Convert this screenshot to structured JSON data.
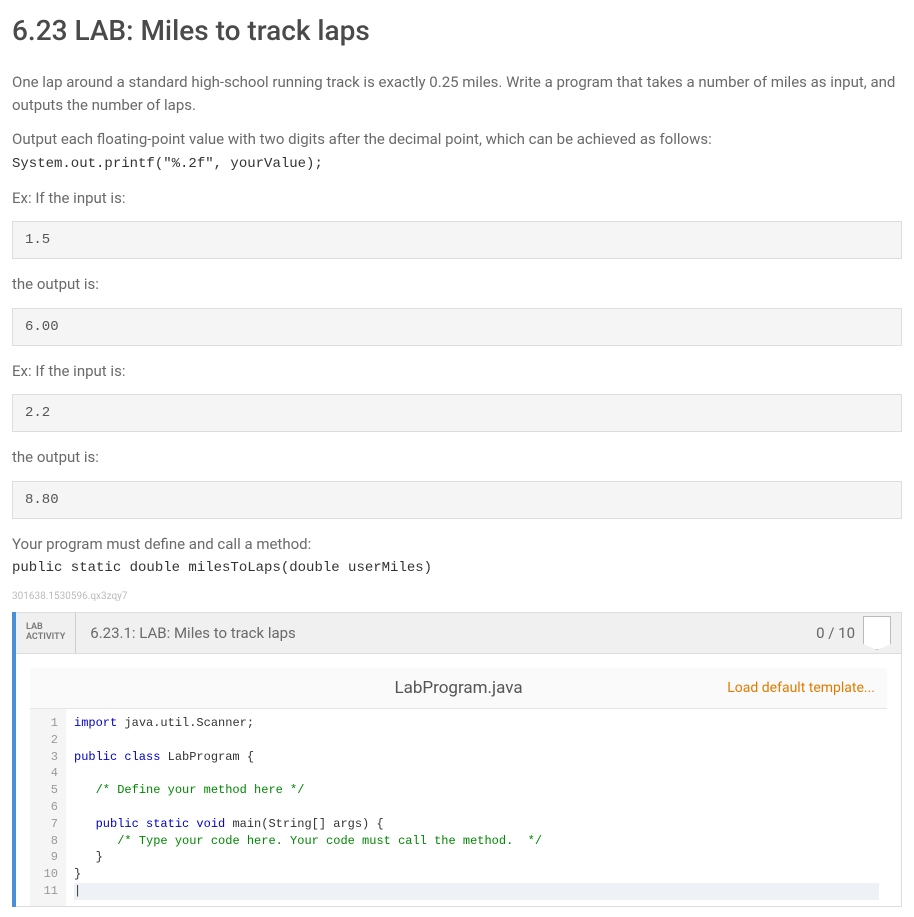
{
  "title": "6.23 LAB: Miles to track laps",
  "intro": "One lap around a standard high-school running track is exactly 0.25 miles. Write a program that takes a number of miles as input, and outputs the number of laps.",
  "output_instr": "Output each floating-point value with two digits after the decimal point, which can be achieved as follows:",
  "output_code": "System.out.printf(\"%.2f\", yourValue);",
  "ex_label_input": "Ex: If the input is:",
  "ex_label_output": "the output is:",
  "examples": [
    {
      "input": "1.5",
      "output": "6.00"
    },
    {
      "input": "2.2",
      "output": "8.80"
    }
  ],
  "method_instr": "Your program must define and call a method:",
  "method_signature": "public static double milesToLaps(double userMiles)",
  "watermark": "301638.1530596.qx3zqy7",
  "lab": {
    "label_top": "LAB",
    "label_bottom": "ACTIVITY",
    "title": "6.23.1: LAB: Miles to track laps",
    "score": "0 / 10",
    "filename": "LabProgram.java",
    "load_template": "Load default template...",
    "code_lines": [
      {
        "n": 1,
        "tokens": [
          {
            "t": "import ",
            "c": "kw"
          },
          {
            "t": "java.util.Scanner;",
            "c": ""
          }
        ]
      },
      {
        "n": 2,
        "tokens": []
      },
      {
        "n": 3,
        "tokens": [
          {
            "t": "public class ",
            "c": "kw"
          },
          {
            "t": "LabProgram {",
            "c": ""
          }
        ]
      },
      {
        "n": 4,
        "tokens": []
      },
      {
        "n": 5,
        "tokens": [
          {
            "t": "   ",
            "c": ""
          },
          {
            "t": "/* Define your method here */",
            "c": "com"
          }
        ]
      },
      {
        "n": 6,
        "tokens": []
      },
      {
        "n": 7,
        "tokens": [
          {
            "t": "   ",
            "c": ""
          },
          {
            "t": "public static void ",
            "c": "kw"
          },
          {
            "t": "main(String[] args) {",
            "c": ""
          }
        ]
      },
      {
        "n": 8,
        "tokens": [
          {
            "t": "      ",
            "c": ""
          },
          {
            "t": "/* Type your code here. Your code must call the method.  */",
            "c": "com"
          }
        ]
      },
      {
        "n": 9,
        "tokens": [
          {
            "t": "   }",
            "c": ""
          }
        ]
      },
      {
        "n": 10,
        "tokens": [
          {
            "t": "}",
            "c": ""
          }
        ]
      },
      {
        "n": 11,
        "tokens": [],
        "cursor": true
      }
    ]
  }
}
